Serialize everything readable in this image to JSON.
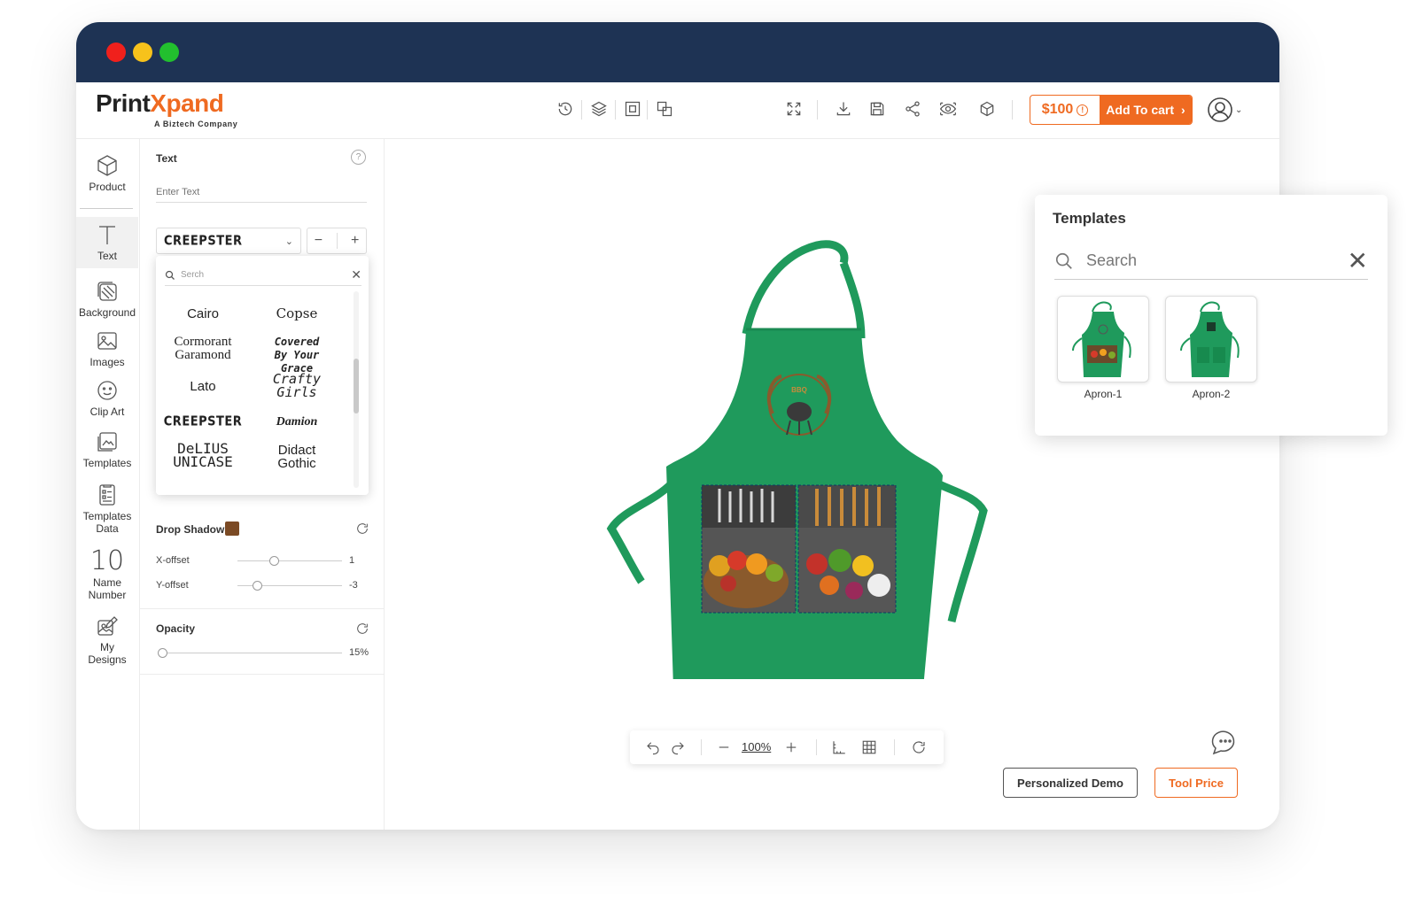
{
  "brand": {
    "name_a": "Print",
    "name_x": "X",
    "name_b": "pand",
    "tagline": "A Biztech Company",
    "accent": "#ef6a21",
    "titlebar_color": "#1e3354",
    "apron_color": "#1f9a5c"
  },
  "header": {
    "price": "$100",
    "price_info": "!",
    "cart_label": "Add To cart"
  },
  "sidebar": {
    "items": [
      {
        "label": "Product"
      },
      {
        "label": "Text"
      },
      {
        "label": "Background"
      },
      {
        "label": "Images"
      },
      {
        "label": "Clip Art"
      },
      {
        "label": "Templates"
      },
      {
        "label": "Templates Data"
      },
      {
        "label": "Name Number",
        "glyph": "10"
      },
      {
        "label": "My Designs"
      }
    ]
  },
  "text_panel": {
    "title": "Text",
    "help": "?",
    "placeholder": "Enter Text",
    "font_selected": "CREEPSTER",
    "stepper_minus": "−",
    "stepper_plus": "+",
    "font_search_placeholder": "Serch",
    "fonts": [
      "Cairo",
      "Copse",
      "Cormorant Garamond",
      "Covered By Your Grace",
      "Lato",
      "Crafty Girls",
      "CREEPSTER",
      "Damion",
      "DeLIUS UNICASE",
      "Didact Gothic"
    ],
    "drop_shadow_label": "Drop Shadow",
    "drop_shadow_color": "#7b4a24",
    "x_offset_label": "X-offset",
    "x_offset_value": "1",
    "y_offset_label": "Y-offset",
    "y_offset_value": "-3",
    "opacity_label": "Opacity",
    "opacity_value": "15%"
  },
  "canvas": {
    "zoom": "100%",
    "demo_button": "Personalized Demo",
    "tool_price_button": "Tool Price"
  },
  "templates": {
    "title": "Templates",
    "search_placeholder": "Search",
    "items": [
      {
        "label": "Apron-1"
      },
      {
        "label": "Apron-2"
      }
    ]
  }
}
